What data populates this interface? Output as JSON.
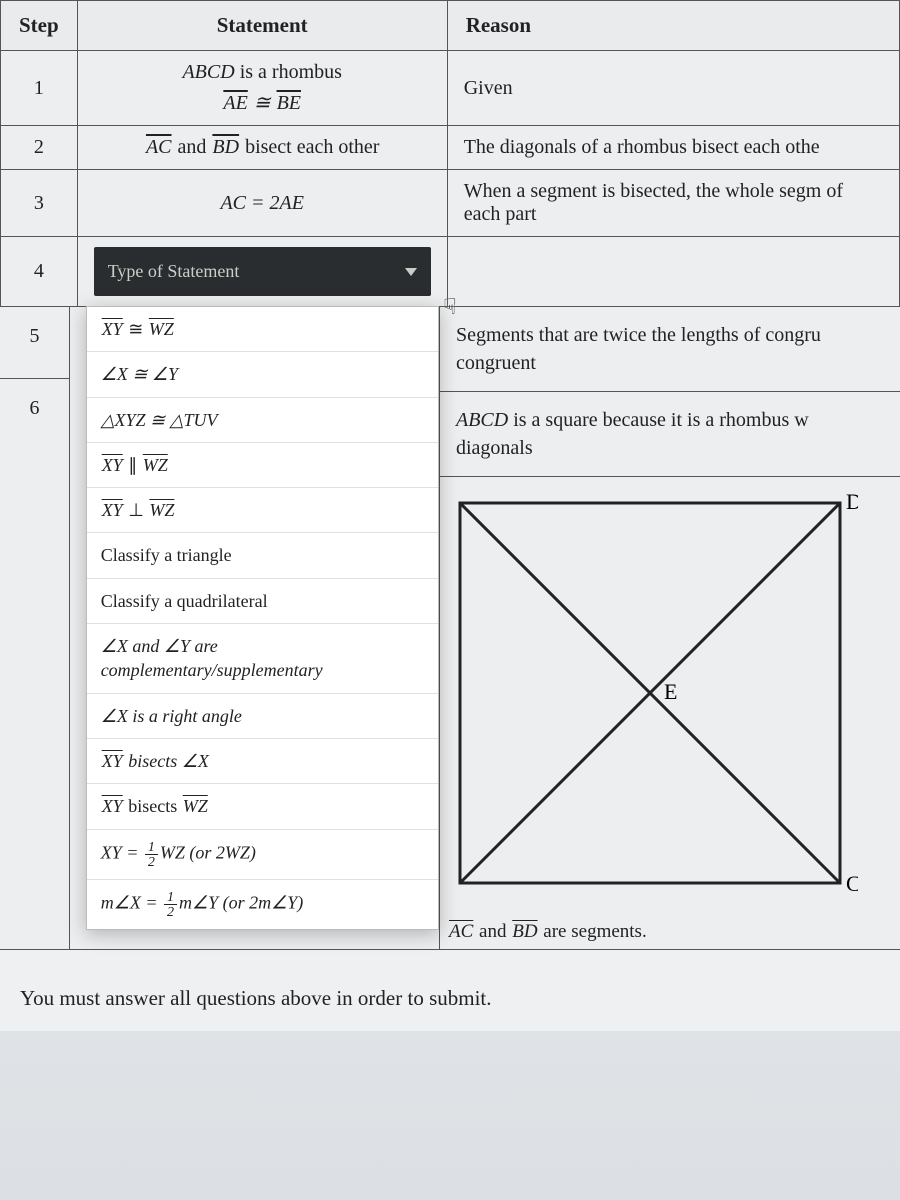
{
  "headers": {
    "step": "Step",
    "statement": "Statement",
    "reason": "Reason"
  },
  "rows": {
    "r1": {
      "num": "1",
      "stmt_a_pre": "",
      "stmt_a_it": "ABCD",
      "stmt_a_post": " is a rhombus",
      "stmt_b_l": "AE",
      "stmt_b_mid": " ≅ ",
      "stmt_b_r": "BE",
      "reason": "Given"
    },
    "r2": {
      "num": "2",
      "stmt_l": "AC",
      "stmt_mid": " and ",
      "stmt_r": "BD",
      "stmt_post": " bisect each other",
      "reason": "The diagonals of a rhombus bisect each othe"
    },
    "r3": {
      "num": "3",
      "stmt_it": "AC = 2AE",
      "reason": "When a segment is bisected, the whole segm of each part"
    },
    "r4": {
      "num": "4"
    },
    "r5": {
      "num": "5",
      "reason": "Segments that are twice the lengths of congru congruent"
    },
    "r6": {
      "num": "6",
      "reason_pre": "",
      "reason_it": "ABCD",
      "reason_post": " is a square because it is a rhombus w diagonals"
    }
  },
  "dropdown": {
    "placeholder": "Type of Statement",
    "opt1_l": "XY",
    "opt1_mid": " ≅ ",
    "opt1_r": "WZ",
    "opt2": "∠X ≅ ∠Y",
    "opt3": "△XYZ ≅ △TUV",
    "opt4_l": "XY",
    "opt4_mid": " ∥ ",
    "opt4_r": "WZ",
    "opt5_l": "XY",
    "opt5_mid": " ⊥ ",
    "opt5_r": "WZ",
    "opt6": "Classify a triangle",
    "opt7": "Classify a quadrilateral",
    "opt8": "∠X and ∠Y are complementary/supplementary",
    "opt9": "∠X is a right angle",
    "opt10_l": "XY",
    "opt10_post": " bisects ∠X",
    "opt11_l": "XY",
    "opt11_mid": " bisects ",
    "opt11_r": "WZ",
    "opt12_pre": "XY = ",
    "opt12_n": "1",
    "opt12_d": "2",
    "opt12_post": "WZ (or 2WZ)",
    "opt13_pre": "m∠X = ",
    "opt13_n": "1",
    "opt13_d": "2",
    "opt13_post": "m∠Y (or 2m∠Y)"
  },
  "diagram": {
    "D": "D",
    "C": "C",
    "E": "E"
  },
  "caption_l": "AC",
  "caption_mid": " and ",
  "caption_r": "BD",
  "caption_post": " are segments.",
  "footer": "You must answer all questions above in order to submit."
}
